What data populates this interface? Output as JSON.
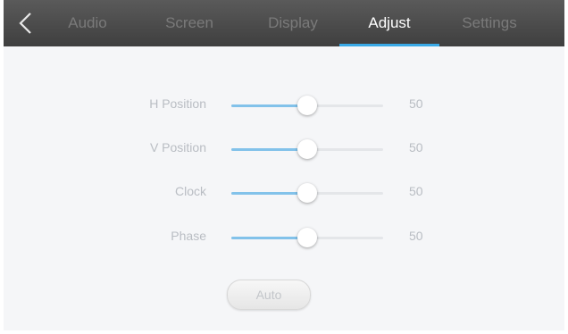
{
  "header": {
    "back_icon": "chevron-left-icon",
    "tabs": [
      {
        "label": "Audio",
        "active": false
      },
      {
        "label": "Screen",
        "active": false
      },
      {
        "label": "Display",
        "active": false
      },
      {
        "label": "Adjust",
        "active": true
      },
      {
        "label": "Settings",
        "active": false
      }
    ]
  },
  "adjust": {
    "sliders": [
      {
        "label": "H Position",
        "value": "50",
        "level": 50
      },
      {
        "label": "V Position",
        "value": "50",
        "level": 50
      },
      {
        "label": "Clock",
        "value": "50",
        "level": 50
      },
      {
        "label": "Phase",
        "value": "50",
        "level": 50
      }
    ],
    "auto_label": "Auto"
  },
  "colors": {
    "accent": "#39a9e6",
    "slider_fill": "#82c2ea",
    "topbar": "#4a4a4a",
    "background": "#f5f6f8"
  }
}
